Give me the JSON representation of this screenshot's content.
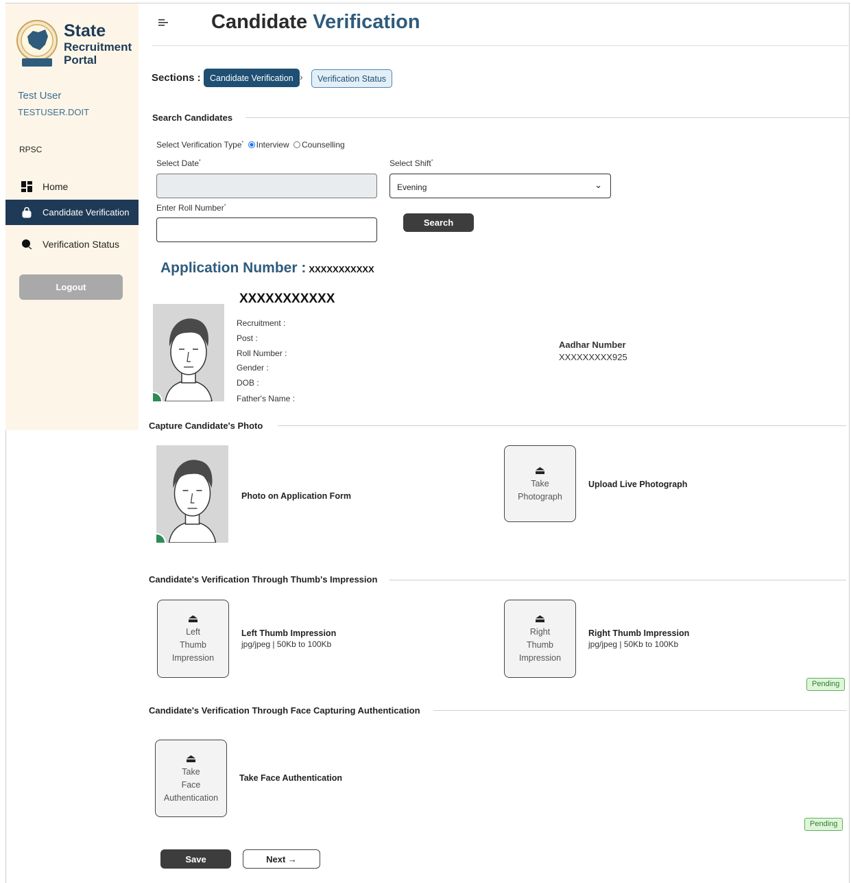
{
  "sidebar": {
    "brand": {
      "line1": "State",
      "line2": "Recruitment",
      "line3": "Portal"
    },
    "user_name": "Test User",
    "user_id": "TESTUSER.DOIT",
    "org": "RPSC",
    "nav": [
      {
        "label": "Home",
        "icon": "dashboard-icon"
      },
      {
        "label": "Candidate Verification",
        "icon": "bag-icon"
      },
      {
        "label": "Verification Status",
        "icon": "status-icon"
      }
    ],
    "logout_label": "Logout"
  },
  "header": {
    "title_part1": "Candidate",
    "title_part2": "Verification"
  },
  "sections": {
    "label": "Sections :",
    "items": [
      "Candidate Verification",
      "Verification Status"
    ]
  },
  "search": {
    "heading": "Search Candidates",
    "verification_type_label": "Select Verification Type",
    "option_interview": "Interview",
    "option_counselling": "Counselling",
    "date_label": "Select Date",
    "shift_label": "Select Shift",
    "shift_value": "Evening",
    "roll_label": "Enter Roll Number",
    "search_button": "Search",
    "required_mark": "*"
  },
  "candidate": {
    "app_number_label": "Application Number :",
    "app_number_value": "XXXXXXXXXXX",
    "name": "XXXXXXXXXXX",
    "fields": [
      "Recruitment :",
      "Post :",
      "Roll Number :",
      "Gender :",
      "DOB :",
      "Father's Name :"
    ],
    "aadhar_label": "Aadhar Number",
    "aadhar_value": "XXXXXXXXX925"
  },
  "capture_photo": {
    "heading": "Capture Candidate's Photo",
    "photo_caption": "Photo on Application Form",
    "take_button": [
      "Take",
      "Photograph"
    ],
    "upload_label": "Upload Live Photograph"
  },
  "thumb": {
    "heading": "Candidate's Verification Through Thumb's Impression",
    "left_button": [
      "Left",
      "Thumb",
      "Impression"
    ],
    "left_label": "Left Thumb Impression",
    "left_sub": "jpg/jpeg | 50Kb to 100Kb",
    "right_button": [
      "Right",
      "Thumb",
      "Impression"
    ],
    "right_label": "Right Thumb Impression",
    "right_sub": "jpg/jpeg | 50Kb to 100Kb",
    "status": "Pending"
  },
  "face": {
    "heading": "Candidate's Verification Through Face Capturing Authentication",
    "button": [
      "Take",
      "Face",
      "Authentication"
    ],
    "label": "Take Face Authentication",
    "status": "Pending"
  },
  "footer": {
    "save_label": "Save",
    "next_label": "Next →"
  },
  "colors": {
    "primary": "#1f4f73",
    "sidebar_bg": "#fdf6e8",
    "title_accent": "#2f5b7c",
    "pending_bg": "#dff5d8"
  }
}
